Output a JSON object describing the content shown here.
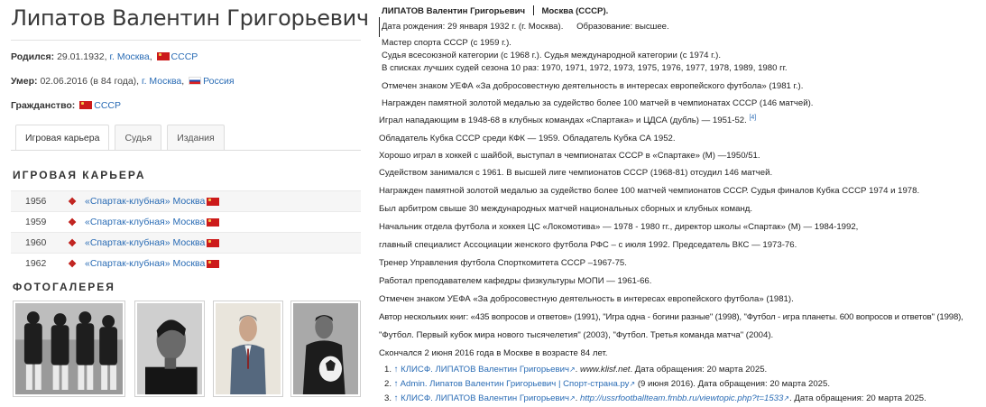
{
  "left": {
    "title": "Липатов Валентин Григорьевич",
    "born_label": "Родился:",
    "born_date": "29.01.1932,",
    "born_city": "г. Москва",
    "born_country": "СССР",
    "died_label": "Умер:",
    "died_date": "02.06.2016 (в 84 года),",
    "died_city": "г. Москва",
    "died_country": "Россия",
    "citizenship_label": "Гражданство:",
    "citizenship_country": "СССР",
    "tabs": [
      "Игровая карьера",
      "Судья",
      "Издания"
    ],
    "career_heading": "ИГРОВАЯ КАРЬЕРА",
    "career": [
      {
        "year": "1956",
        "club": "«Спартак-клубная» Москва"
      },
      {
        "year": "1959",
        "club": "«Спартак-клубная» Москва"
      },
      {
        "year": "1960",
        "club": "«Спартак-клубная» Москва"
      },
      {
        "year": "1962",
        "club": "«Спартак-клубная» Москва"
      }
    ],
    "gallery_heading": "ФОТОГАЛЕРЕЯ",
    "colors": {
      "link": "#2a6cb5",
      "flag_red": "#cc1a1a",
      "club_red": "#c0201c"
    }
  },
  "right": {
    "header_name": "ЛИПАТОВ Валентин Григорьевич",
    "header_place": "Москва (СССР).",
    "birth": "Дата рождения: 29 января 1932 г. (г. Москва).",
    "education": "Образование: высшее.",
    "lines": [
      "Мастер спорта СССР (с 1959 г.).",
      "Судья всесоюзной категории (с 1968 г.).   Судья международной категории (с 1974 г.).",
      "В списках лучших судей сезона 10 раз: 1970, 1971, 1972, 1973, 1975, 1976, 1977, 1978, 1989, 1980 гг.",
      "Отмечен знаком УЕФА «За добросовестную деятельность в интересах европейского футбола» (1981 г.).",
      "Награжден памятной золотой медалью за судейство более 100 матчей в чемпионатах СССР (146 матчей).",
      "Играл нападающим в 1948-68 в клубных командах «Спартака» и ЦДСА (дубль) — 1951-52.",
      "Обладатель Кубка СССР среди КФК — 1959. Обладатель Кубка СА 1952.",
      "Хорошо играл в хоккей с шайбой, выступал в чемпионатах СССР в «Спартаке» (М) —1950/51.",
      "Судейством занимался с 1961. В высшей лиге чемпионатов СССР (1968-81) отсудил 146 матчей.",
      "Награжден памятной золотой медалью за судейство более 100 матчей чемпионатов СССР. Судья финалов Кубка СССР 1974 и 1978.",
      "Был арбитром свыше 30 международных матчей национальных сборных и клубных команд.",
      "Начальник отдела футбола и хоккея ЦС «Локомотива» — 1978 - 1980 гг., директор школы «Спартак» (М) — 1984-1992,",
      "главный специалист Ассоциации женского футбола РФС – с июля 1992. Председатель ВКС — 1973-76.",
      "Тренер Управления футбола Спорткомитета СССР –1967-75.",
      "Работал преподавателем кафедры физкультуры МОПИ — 1961-66.",
      "Отмечен знаком УЕФА «За добросовестную деятельность в интересах европейского футбола» (1981).",
      "Автор нескольких книг: «435 вопросов и ответов» (1991), \"Игра одна - богини разные\" (1998), \"Футбол - игра планеты. 600 вопросов и ответов\" (1998),",
      "\"Футбол. Первый кубок мира нового тысячелетия\" (2003), \"Футбол. Третья команда матча\" (2004).",
      "Скончался 2 июня 2016 года в Москве в возрасте 84 лет."
    ],
    "ref_mark": "[4]",
    "refs": [
      {
        "num": "1.",
        "link": "↑ КЛИСФ. ЛИПАТОВ Валентин Григорьевич",
        "site": "www.klisf.net",
        "date": ". Дата обращения: 20 марта 2025."
      },
      {
        "num": "2.",
        "link": "↑ Admin. Липатов Валентин Григорьевич | Спорт-страна.ру",
        "site": "",
        "date": "(9 июня 2016). Дата обращения: 20 марта 2025."
      },
      {
        "num": "3.",
        "link": "↑ КЛИСФ. ЛИПАТОВ Валентин Григорьевич",
        "site": "http://ussrfootballteam.fmbb.ru/viewtopic.php?t=1533",
        "date": ". Дата обращения: 20 марта 2025."
      }
    ]
  }
}
